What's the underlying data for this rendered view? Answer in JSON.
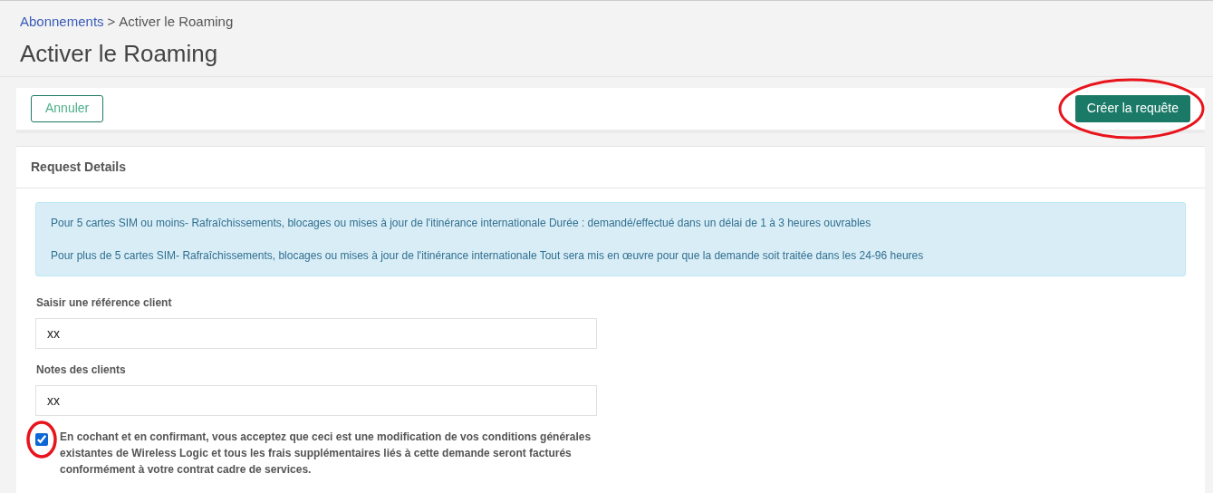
{
  "breadcrumb": {
    "link": "Abonnements",
    "separator": ">",
    "current": "Activer le Roaming"
  },
  "title": "Activer le Roaming",
  "toolbar": {
    "cancel_button": "Annuler",
    "create_button": "Créer la requête"
  },
  "panel": {
    "title": "Request Details",
    "info": [
      "Pour 5 cartes SIM ou moins- Rafraîchissements, blocages ou mises à jour de l'itinérance internationale Durée : demandé/effectué dans un délai de 1 à 3 heures ouvrables",
      "Pour plus de 5 cartes SIM- Rafraîchissements, blocages ou mises à jour de l'itinérance internationale Tout sera mis en œuvre pour que la demande soit traitée dans les 24-96 heures"
    ],
    "fields": [
      {
        "label": "Saisir une référence client",
        "value": "xx"
      },
      {
        "label": "Notes des clients",
        "value": "xx"
      }
    ],
    "consent": {
      "checked": true,
      "text": "En cochant et en confirmant, vous acceptez que ceci est une modification de vos conditions générales existantes de Wireless Logic et tous les frais supplémentaires liés à cette demande seront facturés conformément à votre contrat cadre de services."
    }
  }
}
